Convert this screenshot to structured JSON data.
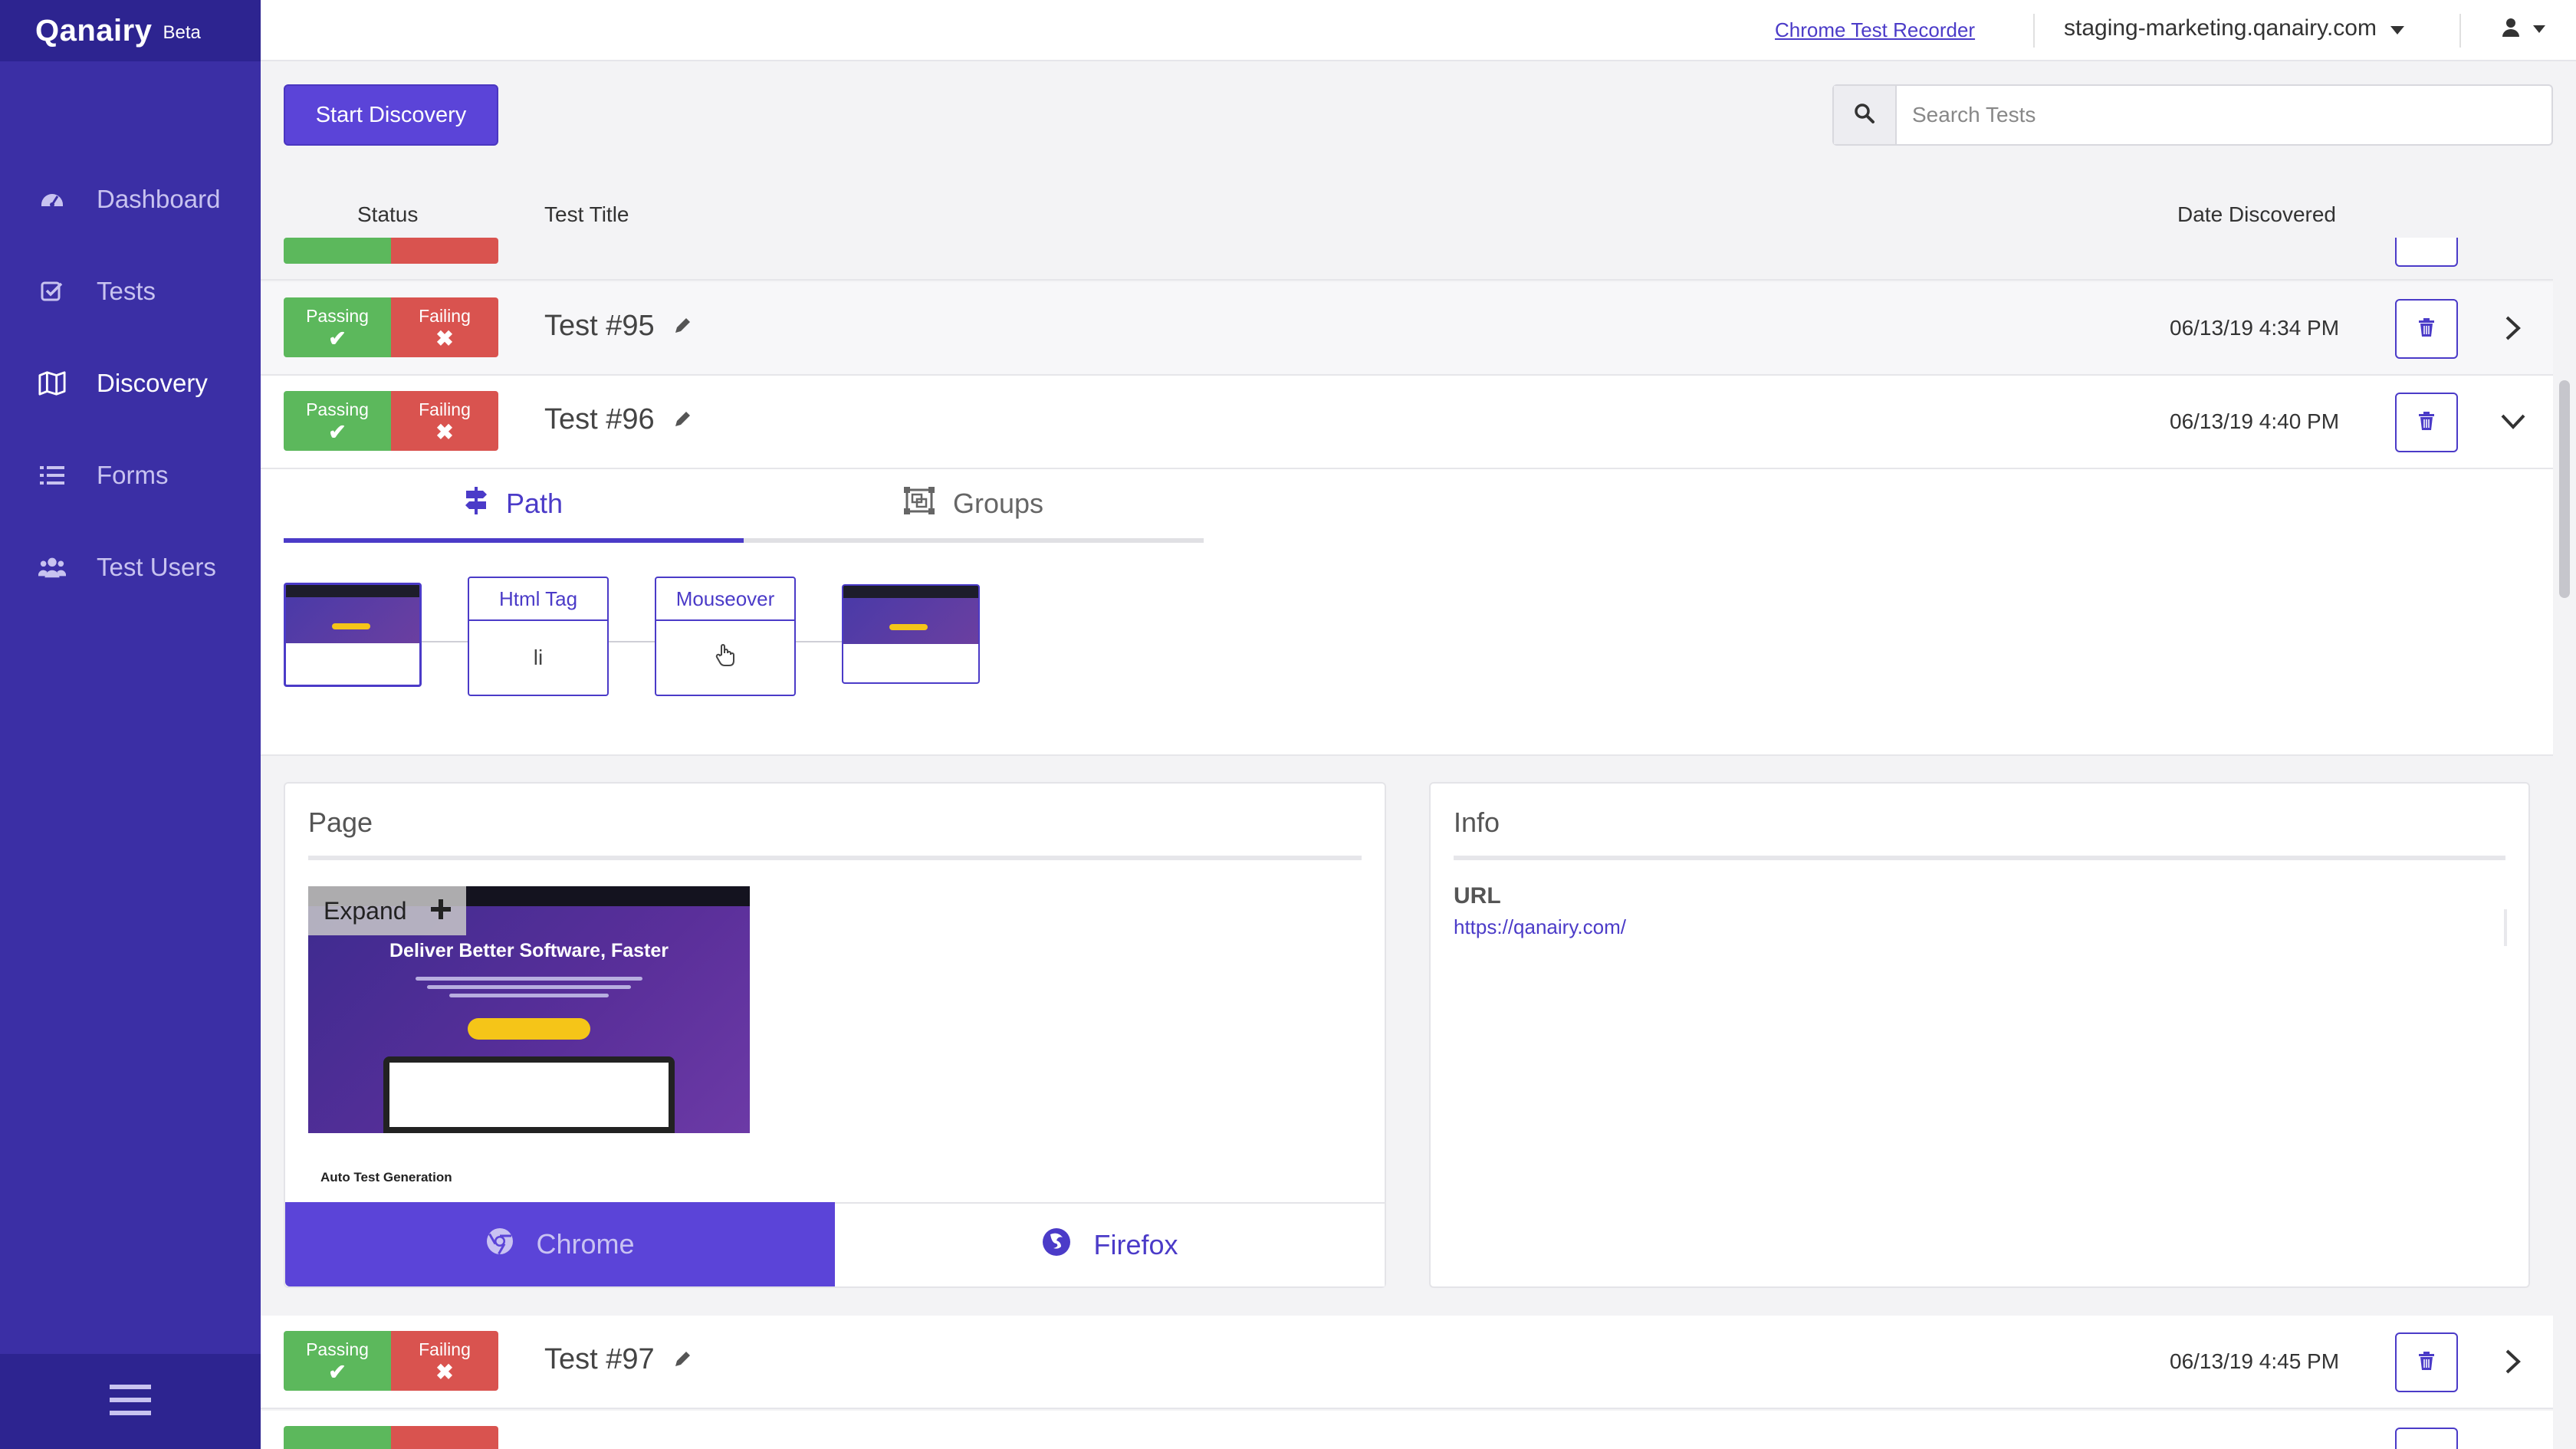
{
  "app": {
    "logo": "Qanairy",
    "beta": "Beta"
  },
  "sidebar": {
    "items": [
      {
        "label": "Dashboard",
        "icon": "dashboard-icon",
        "active": false
      },
      {
        "label": "Tests",
        "icon": "check-square-icon",
        "active": false
      },
      {
        "label": "Discovery",
        "icon": "map-icon",
        "active": true
      },
      {
        "label": "Forms",
        "icon": "list-icon",
        "active": false
      },
      {
        "label": "Test Users",
        "icon": "users-icon",
        "active": false
      }
    ],
    "footer_icon": "hamburger-menu-icon"
  },
  "header": {
    "recorder_link": "Chrome Test Recorder",
    "site": "staging-marketing.qanairy.com"
  },
  "toolbar": {
    "start_label": "Start Discovery",
    "search_placeholder": "Search Tests"
  },
  "columns": {
    "status": "Status",
    "title": "Test Title",
    "date": "Date Discovered"
  },
  "status_labels": {
    "passing": "Passing",
    "failing": "Failing"
  },
  "tests": [
    {
      "title": "Test #95",
      "date": "06/13/19 4:34 PM"
    },
    {
      "title": "Test #96",
      "date": "06/13/19 4:40 PM"
    },
    {
      "title": "Test #97",
      "date": "06/13/19 4:45 PM"
    }
  ],
  "expanded": {
    "tabs": {
      "path": "Path",
      "groups": "Groups"
    },
    "steps": [
      {
        "head": "Html Tag",
        "body": "li"
      },
      {
        "head": "Mouseover",
        "body": ""
      }
    ],
    "page_card": {
      "title": "Page",
      "expand": "Expand",
      "preview_headline": "Deliver Better Software, Faster",
      "preview_caption": "Auto Test Generation",
      "browser_chrome": "Chrome",
      "browser_firefox": "Firefox"
    },
    "info_card": {
      "title": "Info",
      "url_label": "URL",
      "url": "https://qanairy.com/"
    }
  },
  "colors": {
    "sidebar": "#3b2fa5",
    "accent": "#5b44d8",
    "passing": "#5cb85c",
    "failing": "#d9534f"
  }
}
